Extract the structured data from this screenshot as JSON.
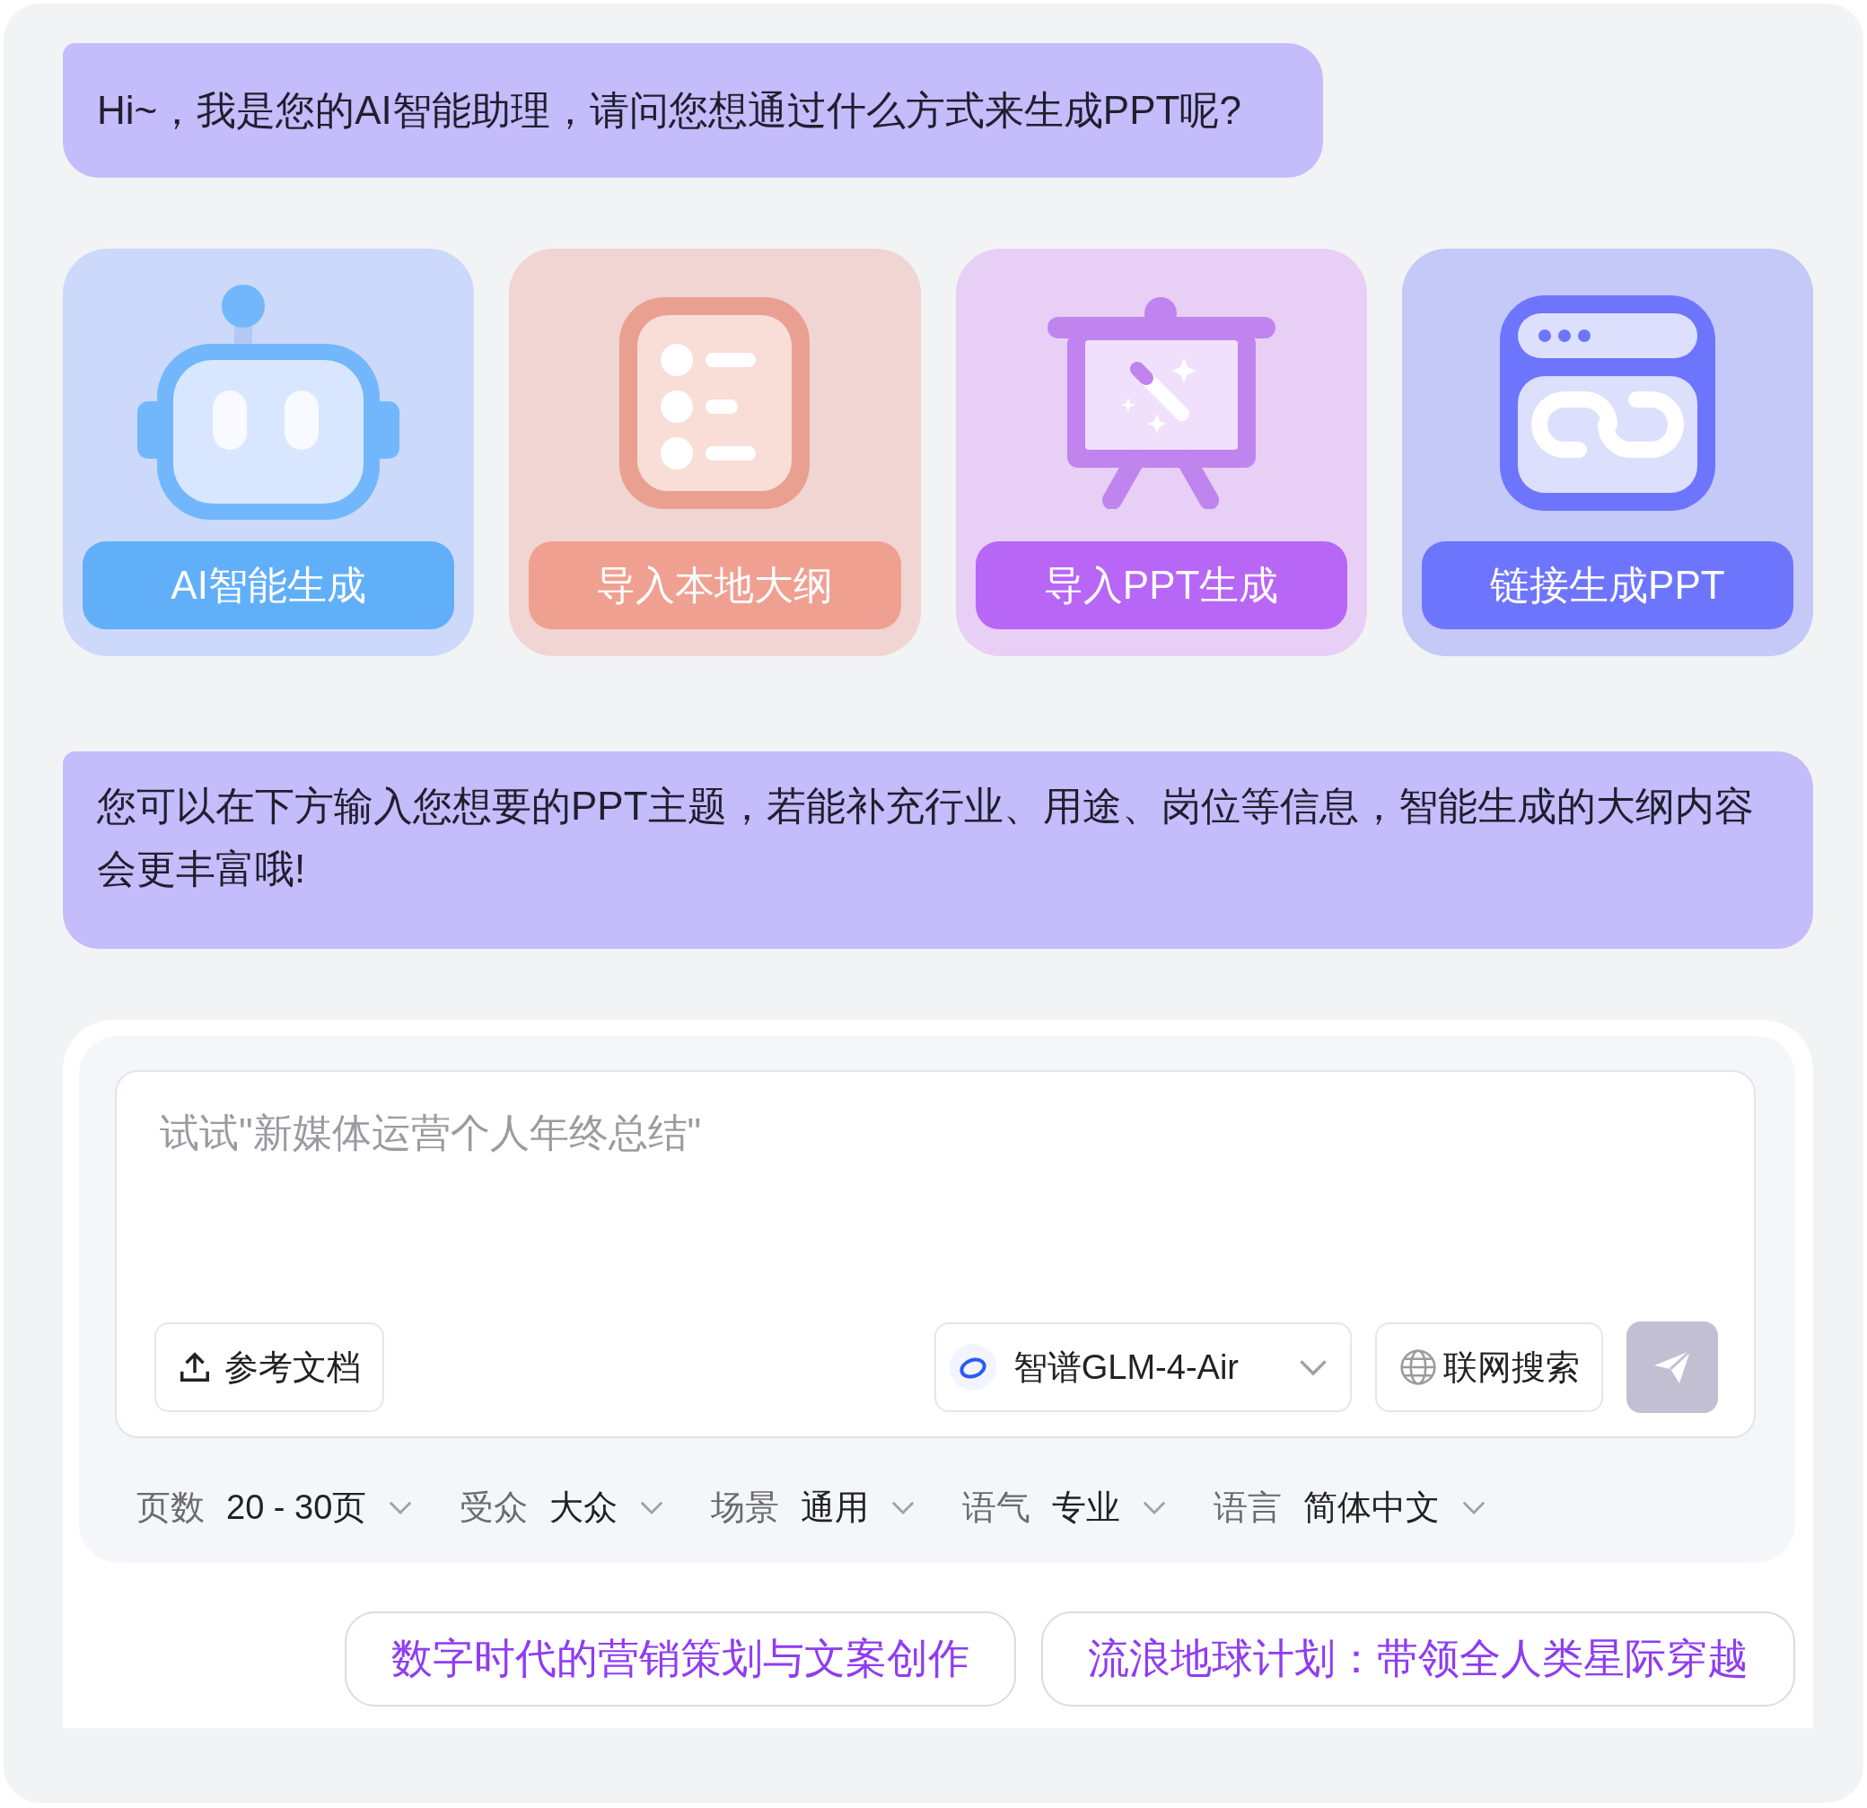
{
  "greeting": "Hi~，我是您的AI智能助理，请问您想通过什么方式来生成PPT呢?",
  "cards": [
    {
      "label": "AI智能生成",
      "kind": "robot"
    },
    {
      "label": "导入本地大纲",
      "kind": "outline"
    },
    {
      "label": "导入PPT生成",
      "kind": "presentation"
    },
    {
      "label": "链接生成PPT",
      "kind": "link"
    }
  ],
  "tip": "您可以在下方输入您想要的PPT主题，若能补充行业、用途、岗位等信息，智能生成的大纲内容会更丰富哦!",
  "composer": {
    "placeholder": "试试\"新媒体运营个人年终总结\"",
    "upload_label": "参考文档",
    "model_label": "智谱GLM-4-Air",
    "web_search_label": "联网搜索",
    "send_disabled": true
  },
  "options": [
    {
      "label": "页数",
      "value": "20 - 30页"
    },
    {
      "label": "受众",
      "value": "大众"
    },
    {
      "label": "场景",
      "value": "通用"
    },
    {
      "label": "语气",
      "value": "专业"
    },
    {
      "label": "语言",
      "value": "简体中文"
    }
  ],
  "suggestions": [
    "数字时代的营销策划与文案创作",
    "流浪地球计划：带领全人类星际穿越"
  ]
}
